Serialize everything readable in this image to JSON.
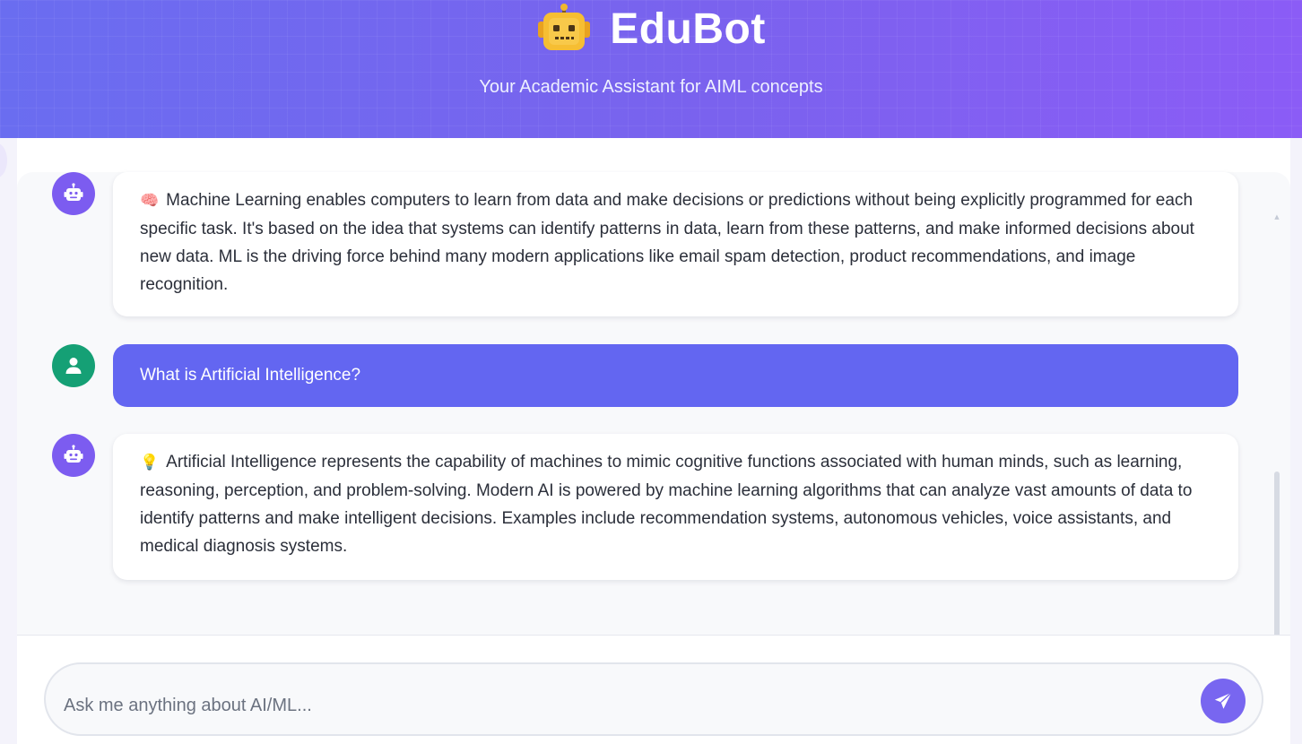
{
  "app": {
    "title": "EduBot",
    "subtitle": "Your Academic Assistant for AIML concepts",
    "logo_icon": "robot-icon"
  },
  "messages": [
    {
      "role": "bot",
      "avatar_icon": "robot-icon",
      "emoji": "🧠",
      "text": "Machine Learning enables computers to learn from data and make decisions or predictions without being explicitly programmed for each specific task. It's based on the idea that systems can identify patterns in data, learn from these patterns, and make informed decisions about new data. ML is the driving force behind many modern applications like email spam detection, product recommendations, and image recognition."
    },
    {
      "role": "user",
      "avatar_icon": "user-icon",
      "text": "What is Artificial Intelligence?"
    },
    {
      "role": "bot",
      "avatar_icon": "robot-icon",
      "emoji": "💡",
      "text": "Artificial Intelligence represents the capability of machines to mimic cognitive functions associated with human minds, such as learning, reasoning, perception, and problem-solving. Modern AI is powered by machine learning algorithms that can analyze vast amounts of data to identify patterns and make intelligent decisions. Examples include recommendation systems, autonomous vehicles, voice assistants, and medical diagnosis systems."
    }
  ],
  "input": {
    "placeholder": "Ask me anything about AI/ML...",
    "value": "",
    "send_icon": "paper-plane-icon"
  },
  "colors": {
    "header_start": "#6a6df0",
    "header_end": "#8b5cf6",
    "bot_avatar": "#7c5cf0",
    "user_avatar": "#15a075",
    "user_bubble": "#6366f1",
    "send_button": "#7866f0"
  }
}
